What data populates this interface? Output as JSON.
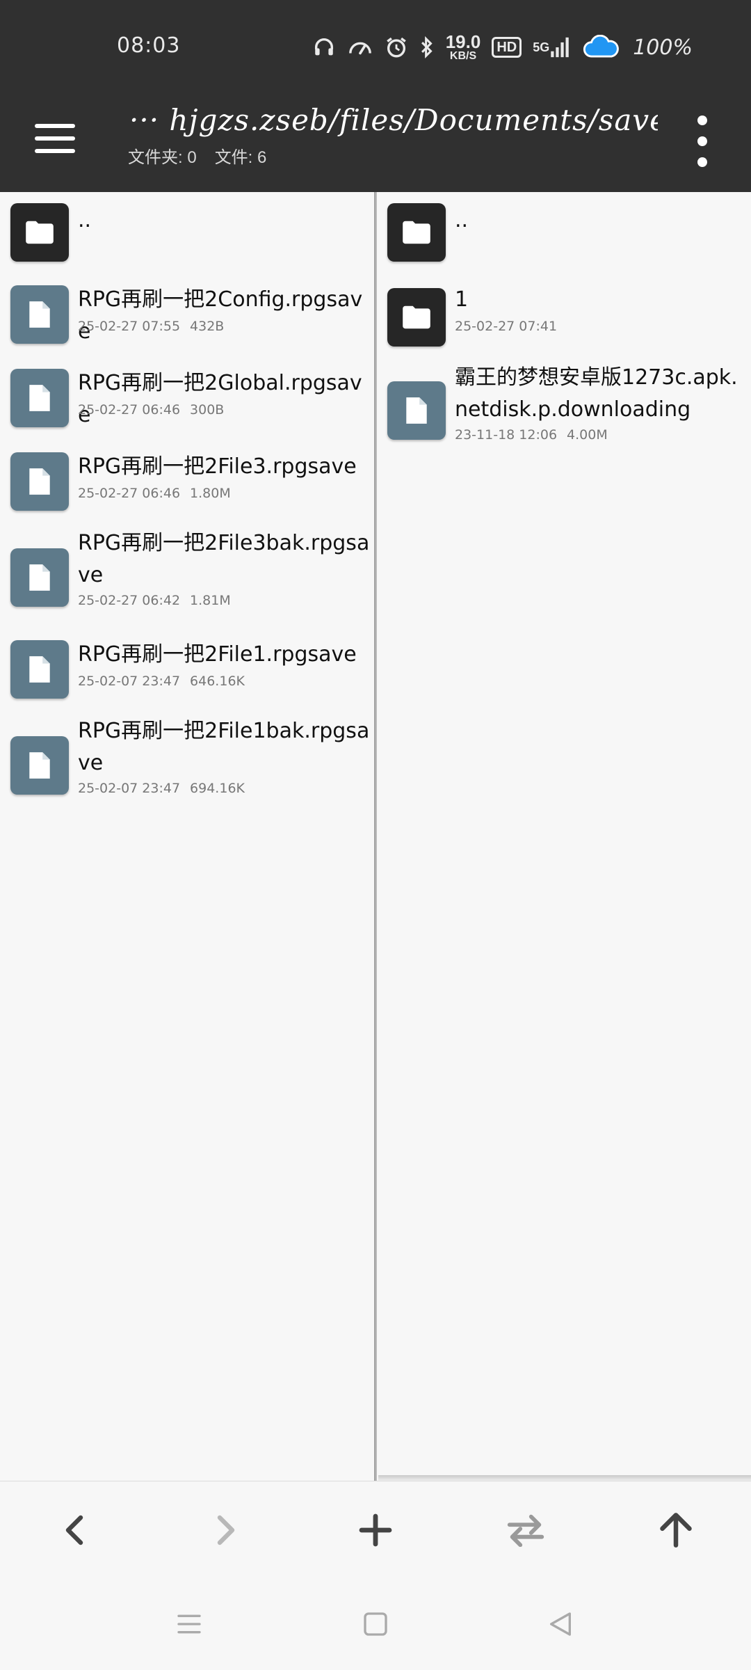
{
  "status_bar": {
    "time": "08:03",
    "net_speed_value": "19.0",
    "net_speed_unit": "KB/S",
    "hd_label": "HD",
    "network_label": "5G",
    "battery": "100%"
  },
  "app_bar": {
    "path": "··· hjgzs.zseb/files/Documents/save/",
    "folders_count": "文件夹: 0",
    "files_count": "文件: 6"
  },
  "left_pane": {
    "parent": "..",
    "items": [
      {
        "name": "RPG再刷一把2Config.rpgsave",
        "date": "25-02-27 07:55",
        "size": "432B"
      },
      {
        "name": "RPG再刷一把2Global.rpgsave",
        "date": "25-02-27 06:46",
        "size": "300B"
      },
      {
        "name": "RPG再刷一把2File3.rpgsave",
        "date": "25-02-27 06:46",
        "size": "1.80M"
      },
      {
        "name": "RPG再刷一把2File3bak.rpgsave",
        "date": "25-02-27 06:42",
        "size": "1.81M"
      },
      {
        "name": "RPG再刷一把2File1.rpgsave",
        "date": "25-02-07 23:47",
        "size": "646.16K"
      },
      {
        "name": "RPG再刷一把2File1bak.rpgsave",
        "date": "25-02-07 23:47",
        "size": "694.16K"
      }
    ]
  },
  "right_pane": {
    "parent": "..",
    "folder": {
      "name": "1",
      "date": "25-02-27 07:41"
    },
    "file": {
      "name": "霸王的梦想安卓版1273c.apk.netdisk.p.downloading",
      "date": "23-11-18 12:06",
      "size": "4.00M"
    }
  },
  "colors": {
    "top_bar": "#303030",
    "folder_icon_bg": "#262626",
    "file_icon_bg": "#5e7a8a",
    "pane_bg": "#f7f7f7"
  },
  "icons": {
    "menu": "menu-icon",
    "more": "more-vert-icon",
    "folder": "folder-icon",
    "file": "file-icon",
    "back": "chevron-left-icon",
    "forward": "chevron-right-icon",
    "add": "plus-icon",
    "swap": "swap-icon",
    "up": "arrow-up-icon"
  }
}
